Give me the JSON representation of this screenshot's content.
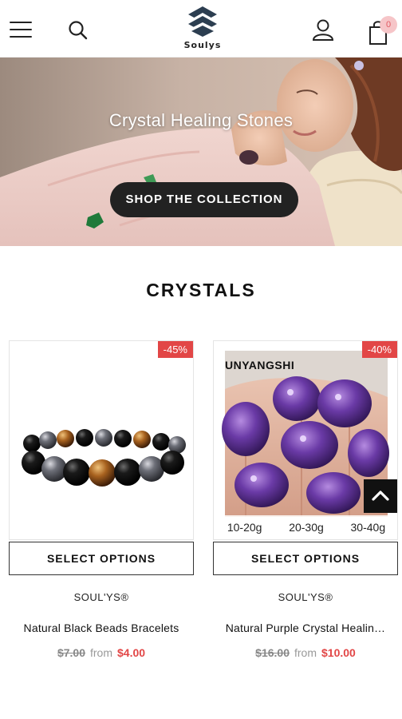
{
  "header": {
    "brand_name": "Soulys",
    "cart_count": "0",
    "icons": [
      "menu-icon",
      "search-icon",
      "logo-icon",
      "user-icon",
      "cart-icon"
    ]
  },
  "hero": {
    "title": "Crystal Healing Stones",
    "button_label": "SHOP THE COLLECTION"
  },
  "section": {
    "title": "CRYSTALS"
  },
  "products": [
    {
      "discount": "-45%",
      "button_label": "SELECT OPTIONS",
      "vendor": "SOUL'YS®",
      "name": "Natural Black Beads Bracelets",
      "price_old": "$7.00",
      "price_from": "from",
      "price_new": "$4.00"
    },
    {
      "discount": "-40%",
      "button_label": "SELECT OPTIONS",
      "vendor": "SOUL'YS®",
      "name": "Natural Purple Crystal Healin…",
      "price_old": "$16.00",
      "price_from": "from",
      "price_new": "$10.00",
      "image_watermark": "UNYANGSHI",
      "variants": [
        "10-20g",
        "20-30g",
        "30-40g"
      ]
    }
  ],
  "colors": {
    "sale_red": "#e24646",
    "button_dark": "#222222",
    "cart_badge_bg": "#f6c5c8"
  }
}
